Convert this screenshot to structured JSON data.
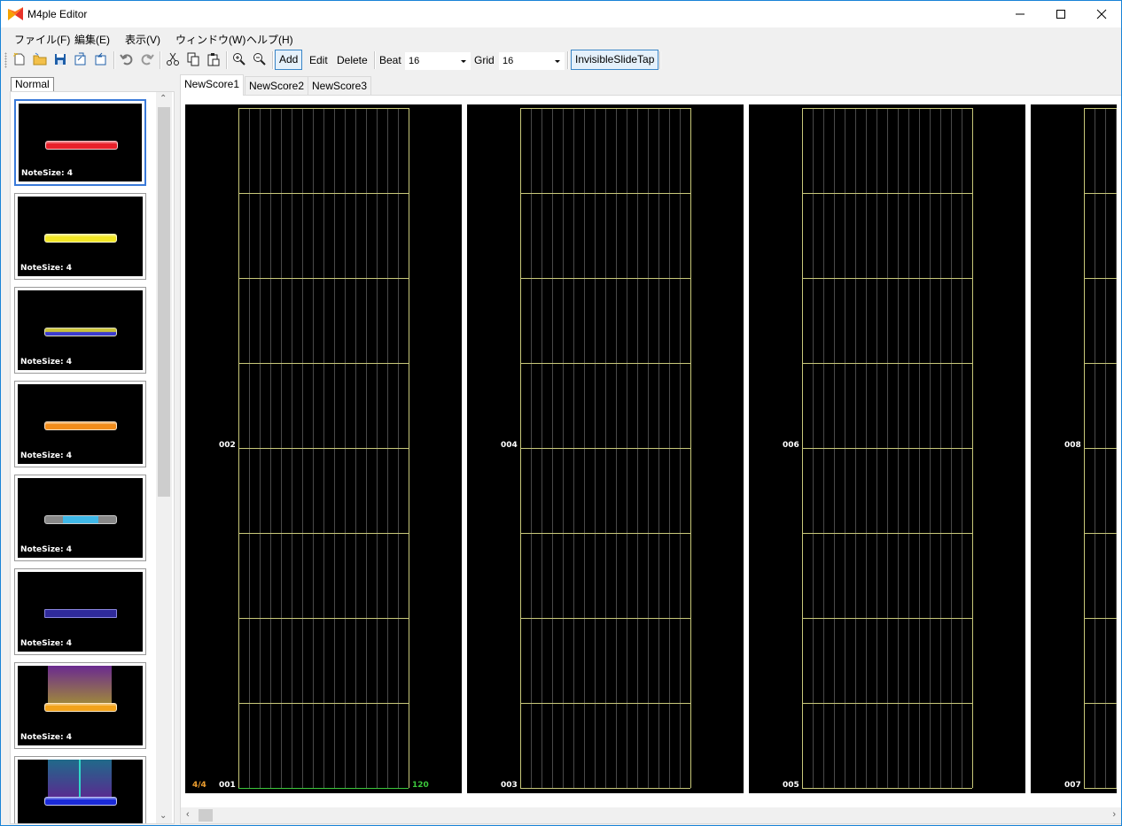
{
  "window": {
    "title": "M4ple Editor"
  },
  "menu": [
    "ファイル(F)",
    "編集(E)",
    "表示(V)",
    "ウィンドウ(W)",
    "ヘルプ(H)"
  ],
  "toolbar": {
    "add_label": "Add",
    "edit_label": "Edit",
    "delete_label": "Delete",
    "beat_label": "Beat",
    "beat_value": "16",
    "grid_label": "Grid",
    "grid_value": "16",
    "invisible_label": "InvisibleSlideTap"
  },
  "palette": {
    "tab_label": "Normal",
    "notes": [
      {
        "label": "NoteSize: 4",
        "color": "#e8202a",
        "kind": "tap"
      },
      {
        "label": "NoteSize: 4",
        "color": "#f2e625",
        "kind": "extap"
      },
      {
        "label": "NoteSize: 4",
        "color": "#c9c23a",
        "kind": "flick"
      },
      {
        "label": "NoteSize: 4",
        "color": "#f28c1a",
        "kind": "hold"
      },
      {
        "label": "NoteSize: 4",
        "color": "#3fb8e8",
        "kind": "slide"
      },
      {
        "label": "NoteSize: 4",
        "color": "#2f2a9a",
        "kind": "air"
      },
      {
        "label": "NoteSize: 4",
        "color": "#f2a21a",
        "kind": "airhold"
      },
      {
        "label": "",
        "color": "#1a2ad8",
        "kind": "airslide"
      }
    ]
  },
  "tabs": [
    "NewScore1",
    "NewScore2",
    "NewScore3"
  ],
  "score": {
    "time_signature": "4/4",
    "bpm": "120",
    "columns": [
      {
        "top": "002",
        "bottom": "001"
      },
      {
        "top": "004",
        "bottom": "003"
      },
      {
        "top": "006",
        "bottom": "005"
      },
      {
        "top": "008",
        "bottom": "007"
      }
    ]
  },
  "colors": {
    "grid_line": "#4a4a4a",
    "measure_line": "#c8c87a",
    "start_line": "#3cc83c",
    "time_signature": "#f0a030",
    "bpm": "#3cc83c"
  }
}
